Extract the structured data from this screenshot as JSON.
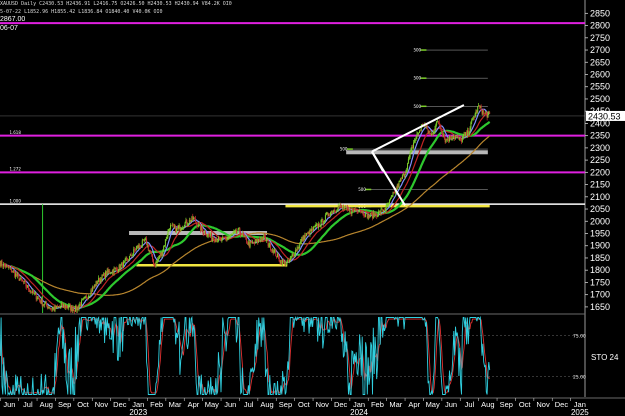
{
  "header": {
    "line1": "XAUUSD Daily  C2430.53  H2436.91  L2416.75  O2426.50  H2430.53  H2430.94  V84.2K  OI0",
    "line2": "5-07-22  L1852.96  H1855.42  L1836.84  O1840.40  V40.0K  OI0"
  },
  "pinned_label": {
    "price": "2867.00",
    "date": "06-07"
  },
  "colors": {
    "background": "#000000",
    "axis_text": "#ffffff",
    "candle_up": "#7ccf2a",
    "candle_down": "#c83232",
    "magenta": "#e020e0",
    "white_line": "#ffffff",
    "yellow": "#f2e640",
    "brown_ma": "#b8862e",
    "green_ma": "#2ec82e",
    "red_ma": "#c02424",
    "blue_ma": "#7f90ff",
    "stoch_k": "#30d0e0",
    "stoch_d": "#e03030"
  },
  "chart_data": {
    "type": "candlestick",
    "symbol": "XAUUSD",
    "timeframe": "Daily",
    "price_ticks": [
      1650,
      1700,
      1750,
      1800,
      1850,
      1900,
      1950,
      2000,
      2050,
      2100,
      2150,
      2200,
      2250,
      2300,
      2350,
      2400,
      2450,
      2500,
      2550,
      2600,
      2650,
      2700,
      2750,
      2800,
      2850
    ],
    "price_range": [
      1625,
      2880
    ],
    "last_price": "2430.53",
    "x_month_labels": [
      "Jun",
      "Jul",
      "Aug",
      "Sep",
      "Oct",
      "Nov",
      "Dec",
      "Jan",
      "Feb",
      "Mar",
      "Apr",
      "May",
      "Jun",
      "Jul",
      "Aug",
      "Sep",
      "Oct",
      "Nov",
      "Dec",
      "Jan",
      "Feb",
      "Mar",
      "Apr",
      "May",
      "Jun",
      "Jul",
      "Aug",
      "Sep",
      "Oct",
      "Nov",
      "Dec",
      "Jan"
    ],
    "x_year_labels": [
      {
        "label": "2023",
        "month_index": 7
      },
      {
        "label": "2024",
        "month_index": 19
      },
      {
        "label": "2025",
        "month_index": 31
      }
    ],
    "anchors": [
      {
        "m": 0,
        "p": 1830
      },
      {
        "m": 0.6,
        "p": 1800
      },
      {
        "m": 1.3,
        "p": 1745
      },
      {
        "m": 1.8,
        "p": 1705
      },
      {
        "m": 2.3,
        "p": 1665
      },
      {
        "m": 2.9,
        "p": 1640
      },
      {
        "m": 3.4,
        "p": 1655
      },
      {
        "m": 4.1,
        "p": 1640
      },
      {
        "m": 4.7,
        "p": 1690
      },
      {
        "m": 5.3,
        "p": 1755
      },
      {
        "m": 5.8,
        "p": 1790
      },
      {
        "m": 6.4,
        "p": 1805
      },
      {
        "m": 6.9,
        "p": 1840
      },
      {
        "m": 7.4,
        "p": 1890
      },
      {
        "m": 7.9,
        "p": 1920
      },
      {
        "m": 8.4,
        "p": 1820
      },
      {
        "m": 8.8,
        "p": 1875
      },
      {
        "m": 9.2,
        "p": 1980
      },
      {
        "m": 9.6,
        "p": 1965
      },
      {
        "m": 10.0,
        "p": 1990
      },
      {
        "m": 10.5,
        "p": 2010
      },
      {
        "m": 11.0,
        "p": 1960
      },
      {
        "m": 11.5,
        "p": 1935
      },
      {
        "m": 12.0,
        "p": 1920
      },
      {
        "m": 12.5,
        "p": 1940
      },
      {
        "m": 13.0,
        "p": 1960
      },
      {
        "m": 13.5,
        "p": 1905
      },
      {
        "m": 13.9,
        "p": 1915
      },
      {
        "m": 14.3,
        "p": 1935
      },
      {
        "m": 14.8,
        "p": 1885
      },
      {
        "m": 15.2,
        "p": 1840
      },
      {
        "m": 15.6,
        "p": 1825
      },
      {
        "m": 16.0,
        "p": 1875
      },
      {
        "m": 16.5,
        "p": 1935
      },
      {
        "m": 16.9,
        "p": 1960
      },
      {
        "m": 17.4,
        "p": 1990
      },
      {
        "m": 17.9,
        "p": 2035
      },
      {
        "m": 18.4,
        "p": 2060
      },
      {
        "m": 19.0,
        "p": 2040
      },
      {
        "m": 19.5,
        "p": 2050
      },
      {
        "m": 20.0,
        "p": 2020
      },
      {
        "m": 20.5,
        "p": 2030
      },
      {
        "m": 21.0,
        "p": 2055
      },
      {
        "m": 21.5,
        "p": 2130
      },
      {
        "m": 22.0,
        "p": 2200
      },
      {
        "m": 22.5,
        "p": 2330
      },
      {
        "m": 23.0,
        "p": 2400
      },
      {
        "m": 23.4,
        "p": 2350
      },
      {
        "m": 23.8,
        "p": 2410
      },
      {
        "m": 24.2,
        "p": 2330
      },
      {
        "m": 24.6,
        "p": 2350
      },
      {
        "m": 25.0,
        "p": 2330
      },
      {
        "m": 25.4,
        "p": 2360
      },
      {
        "m": 25.7,
        "p": 2420
      },
      {
        "m": 26.0,
        "p": 2470
      },
      {
        "m": 26.3,
        "p": 2440
      },
      {
        "m": 26.6,
        "p": 2431
      }
    ],
    "moving_averages": [
      {
        "color_key": "brown_ma",
        "window": 110
      },
      {
        "color_key": "green_ma",
        "window": 38
      },
      {
        "color_key": "red_ma",
        "window": 20
      },
      {
        "color_key": "blue_ma",
        "window": 9
      }
    ],
    "magenta_levels": [
      2350,
      2200,
      2810
    ],
    "white_level": 2070,
    "fib_labels": [
      {
        "text": "1.618",
        "price": 2353,
        "m": 0.5
      },
      {
        "text": "1.272",
        "price": 2203,
        "m": 0.5
      },
      {
        "text": "1.000",
        "price": 2073,
        "m": 0.5
      }
    ],
    "grey_levels": [
      {
        "text": "500",
        "price": 2700,
        "m0": 23.0,
        "m1": 26.5
      },
      {
        "text": "500",
        "price": 2585,
        "m0": 23.0,
        "m1": 26.5
      },
      {
        "text": "500",
        "price": 2470,
        "m0": 23.0,
        "m1": 26.5
      },
      {
        "text": "500",
        "price": 2295,
        "m0": 19.0,
        "m1": 26.5
      },
      {
        "text": "500",
        "price": 2130,
        "m0": 20.0,
        "m1": 26.5
      },
      {
        "text": "500",
        "price": 2060,
        "m0": 20.0,
        "m1": 26.5
      }
    ],
    "yellow_levels": [
      {
        "price": 1820,
        "m0": 7.4,
        "m1": 15.6
      },
      {
        "price": 2062,
        "m0": 15.5,
        "m1": 26.6
      }
    ],
    "white_boxes": [
      {
        "price": 1952,
        "m0": 7.0,
        "m1": 14.5
      },
      {
        "price": 2282,
        "m0": 18.8,
        "m1": 26.5
      }
    ],
    "triangle_lines": [
      [
        {
          "m": 20.2,
          "p": 2285
        },
        {
          "m": 25.2,
          "p": 2475
        }
      ],
      [
        {
          "m": 20.2,
          "p": 2285
        },
        {
          "m": 22.0,
          "p": 2065
        }
      ],
      [
        {
          "m": 20.2,
          "p": 2285
        },
        {
          "m": 20.8,
          "p": 2205
        }
      ]
    ],
    "stochastic": {
      "label": "STO",
      "value": "24",
      "levels": [
        "75.00",
        "25.00"
      ],
      "range": [
        0,
        100
      ]
    }
  }
}
